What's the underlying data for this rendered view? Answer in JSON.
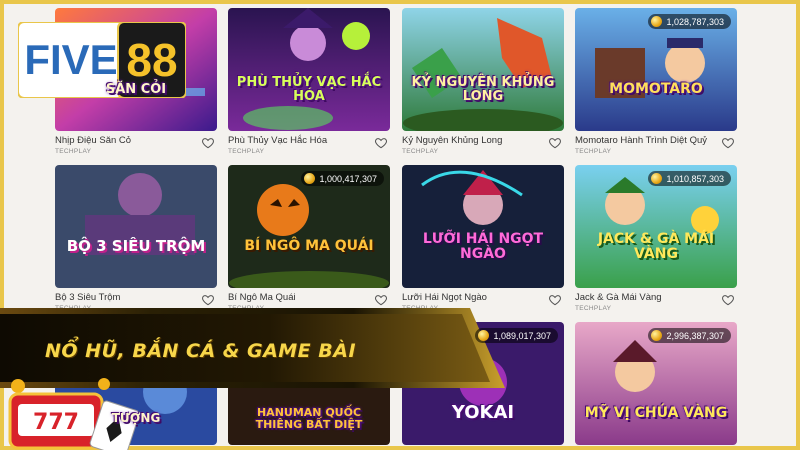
{
  "brand": {
    "part1": "FIVE",
    "part2": "88"
  },
  "banner": {
    "text": "NỔ HŨ, BẮN CÁ & GAME BÀI",
    "slot_number": "777"
  },
  "colors": {
    "gold": "#e9c64a",
    "banner_text": "#f7d64a",
    "card_bg": "#f4f2ee"
  },
  "games": [
    {
      "title": "Nhịp Điệu Săn Cỏ",
      "provider": "TECHPLAY",
      "art_text": "SĂN CỎI",
      "jackpot": ""
    },
    {
      "title": "Phù Thủy Vạc Hắc Hóa",
      "provider": "TECHPLAY",
      "art_text": "PHÙ THỦY VẠC HẮC HÓA",
      "jackpot": ""
    },
    {
      "title": "Kỷ Nguyên Khủng Long",
      "provider": "TECHPLAY",
      "art_text": "KỶ NGUYÊN KHỦNG LONG",
      "jackpot": ""
    },
    {
      "title": "Momotaro Hành Trình Diệt Quỷ",
      "provider": "TECHPLAY",
      "art_text": "MOMOTARO",
      "jackpot": "1,028,787,303"
    },
    {
      "title": "Bộ 3 Siêu Trộm",
      "provider": "TECHPLAY",
      "art_text": "BỘ 3 SIÊU TRỘM",
      "jackpot": ""
    },
    {
      "title": "Bí Ngô Ma Quái",
      "provider": "TECHPLAY",
      "art_text": "BÍ NGÔ MA QUÁI",
      "jackpot": "1,000,417,307"
    },
    {
      "title": "Lưỡi Hái Ngọt Ngào",
      "provider": "TECHPLAY",
      "art_text": "LƯỠI HÁI NGỌT NGÀO",
      "jackpot": ""
    },
    {
      "title": "Jack & Gà Mái Vàng",
      "provider": "TECHPLAY",
      "art_text": "JACK & GÀ MÁI VÀNG",
      "jackpot": "1,010,857,303"
    },
    {
      "title": "",
      "provider": "",
      "art_text": "TƯỢNG",
      "jackpot": ""
    },
    {
      "title": "",
      "provider": "",
      "art_text": "HANUMAN QUỐC THIÊNG BẤT DIỆT",
      "jackpot": ""
    },
    {
      "title": "",
      "provider": "",
      "art_text": "YOKAI",
      "jackpot": "1,089,017,307"
    },
    {
      "title": "",
      "provider": "",
      "art_text": "MỸ VỊ CHÚA VÀNG",
      "jackpot": "2,996,387,307"
    }
  ]
}
